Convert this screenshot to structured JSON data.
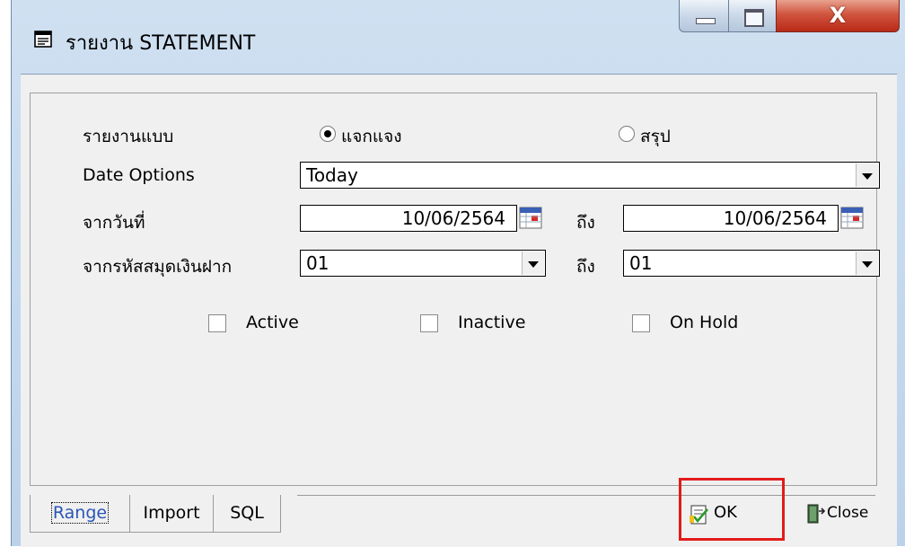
{
  "window": {
    "title": "รายงาน STATEMENT",
    "icon": "report-icon",
    "controls": {
      "minimize_icon": "minimize-icon",
      "maximize_icon": "maximize-icon",
      "close_glyph": "X"
    }
  },
  "form": {
    "report_type": {
      "label": "รายงานแบบ",
      "options": [
        {
          "label": "แจกแจง",
          "selected": true
        },
        {
          "label": "สรุป",
          "selected": false
        }
      ]
    },
    "date_options": {
      "label": "Date Options",
      "value": "Today"
    },
    "date_range": {
      "label": "จากวันที่",
      "from": "10/06/2564",
      "to_label": "ถึง",
      "to": "10/06/2564"
    },
    "account_range": {
      "label": "จากรหัสสมุดเงินฝาก",
      "from": "01",
      "to_label": "ถึง",
      "to": "01"
    },
    "status_filters": [
      {
        "label": "Active",
        "checked": false
      },
      {
        "label": "Inactive",
        "checked": false
      },
      {
        "label": "On Hold",
        "checked": false
      }
    ]
  },
  "tabs": [
    {
      "label": "Range",
      "active": true
    },
    {
      "label": "Import",
      "active": false
    },
    {
      "label": "SQL",
      "active": false
    }
  ],
  "buttons": {
    "ok": {
      "label": "OK",
      "icon": "ok-report-icon"
    },
    "close": {
      "label": "Close",
      "icon": "exit-door-icon"
    }
  },
  "colors": {
    "highlight": "#e21b1b",
    "active_tab_text": "#2a55b8"
  }
}
